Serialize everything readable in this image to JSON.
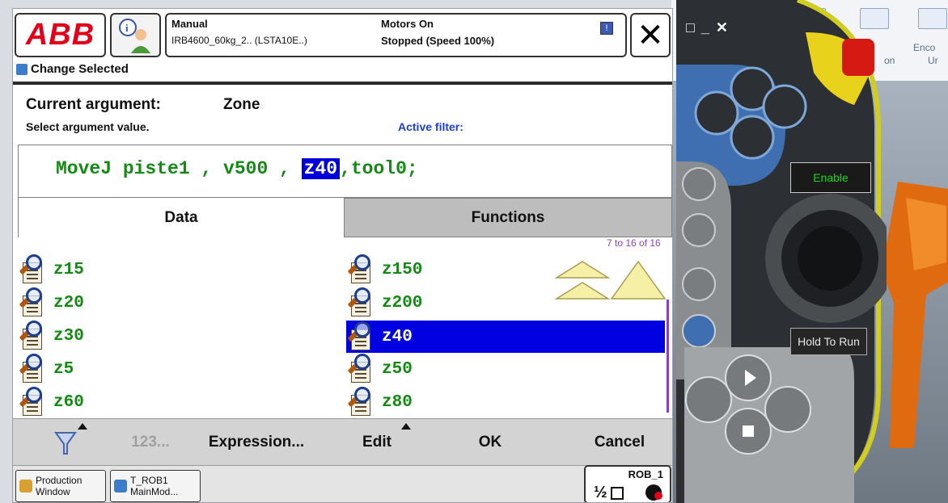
{
  "header": {
    "logo_text": "ABB",
    "mode": "Manual",
    "robot": "IRB4600_60kg_2.. (LSTA10E..)",
    "motors": "Motors On",
    "status": "Stopped (Speed 100%)",
    "close_glyph": "✕"
  },
  "breadcrumb": "Change Selected",
  "argument": {
    "label": "Current argument:",
    "value": "Zone",
    "hint": "Select argument value.",
    "filter": "Active filter:"
  },
  "instruction": {
    "part1": "MoveJ piste1 , v500 , ",
    "highlight": "z40",
    "part2": ",tool0;"
  },
  "tabs": {
    "data": "Data",
    "functions": "Functions"
  },
  "list": {
    "counter": "7 to 16 of 16",
    "left": [
      "z15",
      "z20",
      "z30",
      "z5",
      "z60"
    ],
    "right": [
      "z150",
      "z200",
      "z40",
      "z50",
      "z80"
    ],
    "selected": "z40"
  },
  "bottom_bar": {
    "num": "123...",
    "expression": "Expression...",
    "edit": "Edit",
    "ok": "OK",
    "cancel": "Cancel"
  },
  "taskbar": {
    "production_line1": "Production",
    "production_line2": "Window",
    "task_line1": "T_ROB1",
    "task_line2": "MainMod...",
    "rob": "ROB_1"
  },
  "pendant": {
    "enable": "Enable",
    "hold_to_run": "Hold To Run"
  },
  "background": {
    "ribbon_text1": "Enco",
    "ribbon_text2": "on",
    "ribbon_text3": "Ur"
  },
  "colors": {
    "abb_red": "#e2001a",
    "code_green": "#148a14",
    "selection_blue": "#0000e0",
    "filter_blue": "#1a3fd2",
    "enable_green": "#18d818"
  }
}
